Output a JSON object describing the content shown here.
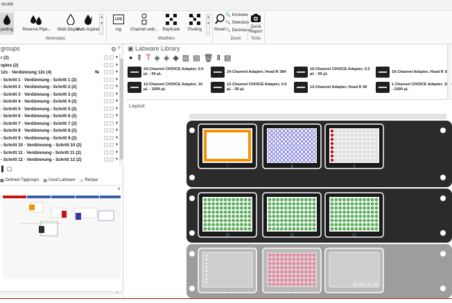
{
  "titlebar": {
    "title": "ecute"
  },
  "ribbon": {
    "buttons": [
      {
        "label": "petting",
        "icon": "drop-icon"
      },
      {
        "label": "Reverse Pipe...",
        "icon": "drops-icon"
      },
      {
        "label": "Multi-Dispen...",
        "icon": "drop-outline-icon"
      },
      {
        "label": "Multi-Aspirate",
        "icon": "drop-arrow-icon"
      },
      {
        "label": "log",
        "icon": "log-icon",
        "icon_text": "LOG"
      },
      {
        "label": "Channel setti...",
        "icon": "channel-icon"
      },
      {
        "label": "Replicate",
        "icon": "replicate-icon"
      },
      {
        "label": "Pooling",
        "icon": "pooling-icon"
      },
      {
        "label": "Reset",
        "icon": "reset-zoom-icon"
      },
      {
        "label": "Quick Report",
        "icon": "camera-icon"
      }
    ],
    "zoom_small": [
      "Increase",
      "Selection",
      "Decrease"
    ],
    "groups": [
      "Worksteps",
      "Modifiers",
      "Zoom",
      "Tools"
    ]
  },
  "groups_panel": {
    "title": "groups",
    "rows": [
      "r (2)",
      "nples (2)",
      "12x · Verdünnung 12x (4)",
      "- Schritt 1 · Verdünnung - Schritt 1  (2)",
      "- Schritt 2 · Verdünnung - Schritt 2  (2)",
      "- Schritt 3 · Verdünnung - Schritt 3  (2)",
      "- Schritt 4 · Verdünnung - Schritt 4  (2)",
      "- Schritt 5 · Verdünnung - Schritt 5  (2)",
      "- Schritt 6 · Verdünnung - Schritt 6  (2)",
      "- Schritt 7 · Verdünnung - Schritt 7  (2)",
      "- Schritt 8 · Verdünnung - Schritt 8  (2)",
      "- Schritt 9 · Verdünnung - Schritt 9  (2)",
      "- Schritt 10 · Verdünnung - Schritt 10  (2)",
      "- Schritt 11 · Verdünnung - Schritt 11  (2)",
      "- Schritt 12 · Verdünnung - Schritt 12  (2)"
    ],
    "tabs": [
      "Defined Tipgroups",
      "Used Labware",
      "Recipe"
    ]
  },
  "library": {
    "title": "Labware Library",
    "items": [
      "24-Channel CHOICE Adapter, 0.5 µL - 50 µL",
      "24-Channel Adapter, Head R 384",
      "16-Channel CHOICE Adapter, 0.5 µL - 50 µL",
      "16-Channel Adapter, Head R 384",
      "12-Channel CHOICE Adapter, 10 µL - 1000 µL",
      "12-Channel CHOICE Adapter, 0.5 µL - 50 µL",
      "12-Channel Adapter, Head R 96",
      "1-Channel CHOICE Adapter, 10 µL - 1000 µL"
    ]
  },
  "layout": {
    "title": "Layout",
    "positions": [
      "7",
      "8",
      "9",
      "10",
      "11",
      "12",
      "1",
      "2",
      "3"
    ],
    "plate_label": "01-7357-11-120"
  },
  "colors": {
    "orange": "#f39200",
    "blue_wells": "#4b4bd8",
    "green_wells": "#5fb05f",
    "pink_wells": "#e68aa0",
    "deck_dark": "#2b2b2b",
    "deck_grey": "#9d9d9d"
  }
}
